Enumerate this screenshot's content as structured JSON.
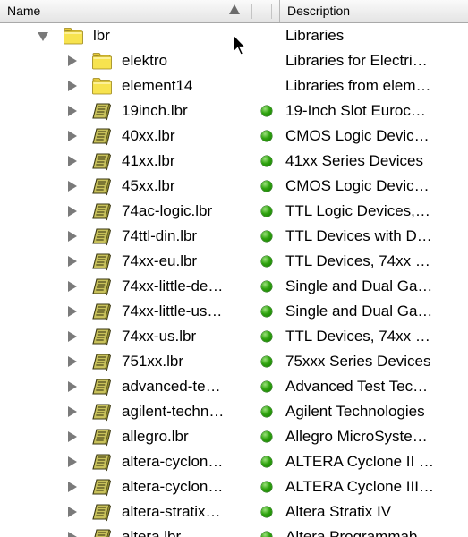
{
  "header": {
    "name_label": "Name",
    "description_label": "Description",
    "sort": "ascending"
  },
  "rows": [
    {
      "name": "lbr",
      "description": "Libraries",
      "type": "folder",
      "expanded": true,
      "level": 0,
      "status": ""
    },
    {
      "name": "elektro",
      "description": "Libraries for Electri…",
      "type": "folder",
      "expanded": false,
      "level": 1,
      "status": ""
    },
    {
      "name": "element14",
      "description": "Libraries from elem…",
      "type": "folder",
      "expanded": false,
      "level": 1,
      "status": ""
    },
    {
      "name": "19inch.lbr",
      "description": "19-Inch Slot Euroc…",
      "type": "library",
      "expanded": false,
      "level": 1,
      "status": "in-use"
    },
    {
      "name": "40xx.lbr",
      "description": "CMOS Logic Devic…",
      "type": "library",
      "expanded": false,
      "level": 1,
      "status": "in-use"
    },
    {
      "name": "41xx.lbr",
      "description": "41xx Series Devices",
      "type": "library",
      "expanded": false,
      "level": 1,
      "status": "in-use"
    },
    {
      "name": "45xx.lbr",
      "description": "CMOS Logic Devic…",
      "type": "library",
      "expanded": false,
      "level": 1,
      "status": "in-use"
    },
    {
      "name": "74ac-logic.lbr",
      "description": "TTL Logic Devices,…",
      "type": "library",
      "expanded": false,
      "level": 1,
      "status": "in-use"
    },
    {
      "name": "74ttl-din.lbr",
      "description": "TTL Devices with D…",
      "type": "library",
      "expanded": false,
      "level": 1,
      "status": "in-use"
    },
    {
      "name": "74xx-eu.lbr",
      "description": "TTL Devices, 74xx …",
      "type": "library",
      "expanded": false,
      "level": 1,
      "status": "in-use"
    },
    {
      "name": "74xx-little-de…",
      "description": "Single and Dual Ga…",
      "type": "library",
      "expanded": false,
      "level": 1,
      "status": "in-use"
    },
    {
      "name": "74xx-little-us…",
      "description": "Single and Dual Ga…",
      "type": "library",
      "expanded": false,
      "level": 1,
      "status": "in-use"
    },
    {
      "name": "74xx-us.lbr",
      "description": "TTL Devices, 74xx …",
      "type": "library",
      "expanded": false,
      "level": 1,
      "status": "in-use"
    },
    {
      "name": "751xx.lbr",
      "description": "75xxx Series Devices",
      "type": "library",
      "expanded": false,
      "level": 1,
      "status": "in-use"
    },
    {
      "name": "advanced-te…",
      "description": "Advanced Test Tec…",
      "type": "library",
      "expanded": false,
      "level": 1,
      "status": "in-use"
    },
    {
      "name": "agilent-techn…",
      "description": "Agilent Technologies",
      "type": "library",
      "expanded": false,
      "level": 1,
      "status": "in-use"
    },
    {
      "name": "allegro.lbr",
      "description": "Allegro MicroSyste…",
      "type": "library",
      "expanded": false,
      "level": 1,
      "status": "in-use"
    },
    {
      "name": "altera-cyclon…",
      "description": "ALTERA Cyclone II …",
      "type": "library",
      "expanded": false,
      "level": 1,
      "status": "in-use"
    },
    {
      "name": "altera-cyclon…",
      "description": "ALTERA Cyclone III…",
      "type": "library",
      "expanded": false,
      "level": 1,
      "status": "in-use"
    },
    {
      "name": "altera-stratix…",
      "description": "Altera Stratix IV",
      "type": "library",
      "expanded": false,
      "level": 1,
      "status": "in-use"
    },
    {
      "name": "altera.lbr",
      "description": "Altera Programmab…",
      "type": "library",
      "expanded": false,
      "level": 1,
      "status": "in-use"
    }
  ],
  "colors": {
    "status_in_use": "#2fa40f",
    "folder": "#f7e34f",
    "library_book": "#8f8a2e"
  },
  "icons": {
    "folder": "folder-icon",
    "library": "library-book-icon",
    "status": "green-status-dot-icon",
    "disclosure": "disclosure-triangle-icon",
    "sort": "sort-ascending-icon",
    "cursor": "mouse-pointer-icon"
  }
}
